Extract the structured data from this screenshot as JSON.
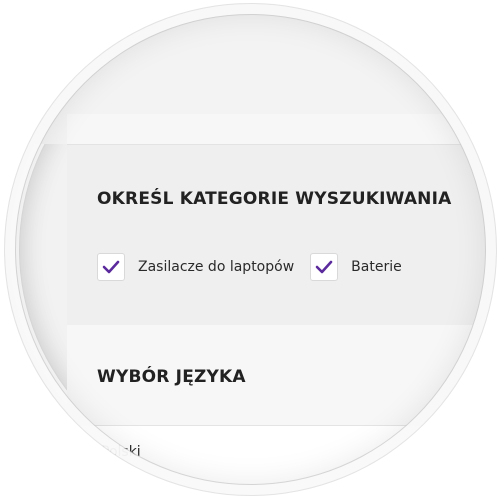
{
  "categories": {
    "title": "OKREŚL KATEGORIE WYSZUKIWANIA",
    "options": [
      {
        "label": "Zasilacze do laptopów",
        "checked": true
      },
      {
        "label": "Baterie",
        "checked": true
      }
    ]
  },
  "language": {
    "title": "WYBÓR JĘZYKA",
    "options": [
      {
        "label": "Polski"
      }
    ]
  },
  "colors": {
    "check_accent": "#5b2a9c",
    "panel_bg": "#efefef",
    "text": "#222222"
  },
  "icons": {
    "checkbox_check": "check-icon"
  }
}
